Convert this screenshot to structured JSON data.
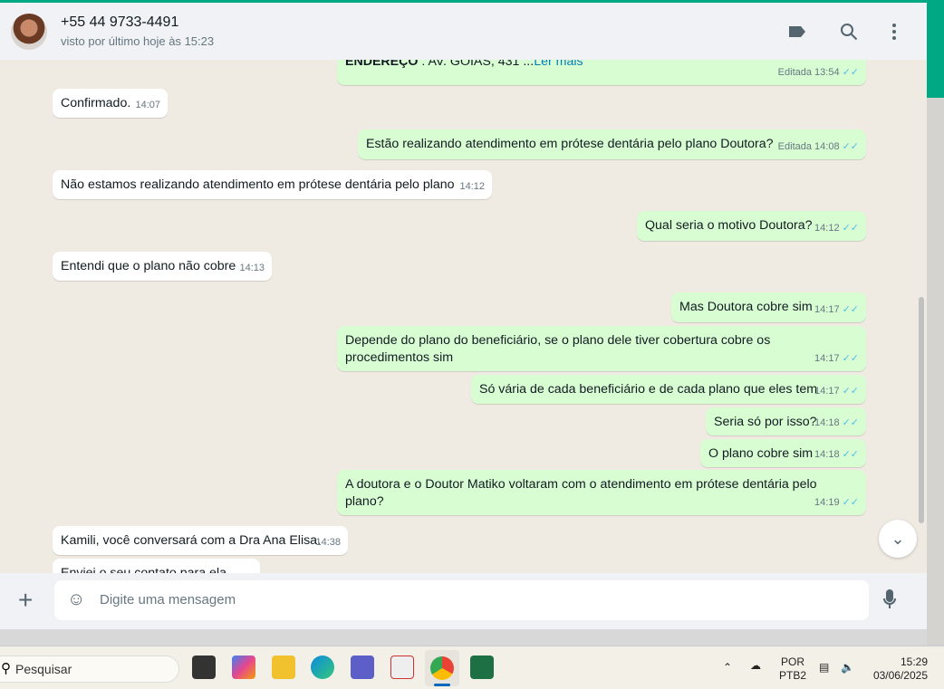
{
  "header": {
    "contact": "+55 44 9733-4491",
    "last_seen": "visto por último hoje às 15:23",
    "icons": [
      "label-icon",
      "search-icon",
      "menu-icon"
    ]
  },
  "messages": [
    {
      "dir": "out",
      "html_bold": "ENDEREÇO",
      "text": " : AV. GOIAS, 431 ...",
      "link": "Ler mais",
      "edited": "Editada",
      "time": "13:54"
    },
    {
      "dir": "in",
      "text": "Confirmado.",
      "time": "14:07"
    },
    {
      "dir": "out",
      "text": "Estão realizando atendimento em prótese dentária pelo plano Doutora?",
      "edited": "Editada",
      "time": "14:08"
    },
    {
      "dir": "in",
      "text": "Não estamos realizando atendimento em prótese dentária pelo plano",
      "time": "14:12"
    },
    {
      "dir": "out",
      "text": "Qual seria o motivo Doutora?",
      "time": "14:12"
    },
    {
      "dir": "in",
      "text": "Entendi que o plano não cobre",
      "time": "14:13"
    },
    {
      "dir": "out",
      "text": "Mas Doutora cobre sim",
      "time": "14:17"
    },
    {
      "dir": "out",
      "text": "Depende do plano do beneficiário, se o plano dele tiver cobertura cobre os procedimentos sim",
      "time": "14:17"
    },
    {
      "dir": "out",
      "text": "Só vária de cada beneficiário e de cada plano que eles tem",
      "time": "14:17"
    },
    {
      "dir": "out",
      "text": "Seria só por isso?",
      "time": "14:18"
    },
    {
      "dir": "out",
      "text": "O plano cobre sim",
      "time": "14:18"
    },
    {
      "dir": "out",
      "text": "A doutora e o Doutor Matiko voltaram com o atendimento em prótese dentária pelo plano?",
      "time": "14:19"
    },
    {
      "dir": "in",
      "text": "Kamili, você conversará com a Dra Ana Elisa.",
      "time": "14:38"
    },
    {
      "dir": "in",
      "text": "Enviei o seu contato para ela"
    }
  ],
  "input": {
    "placeholder": "Digite uma mensagem"
  },
  "taskbar": {
    "search": "Pesquisar",
    "lang1": "POR",
    "lang2": "PTB2",
    "time": "15:29",
    "date": "03/06/2025"
  }
}
